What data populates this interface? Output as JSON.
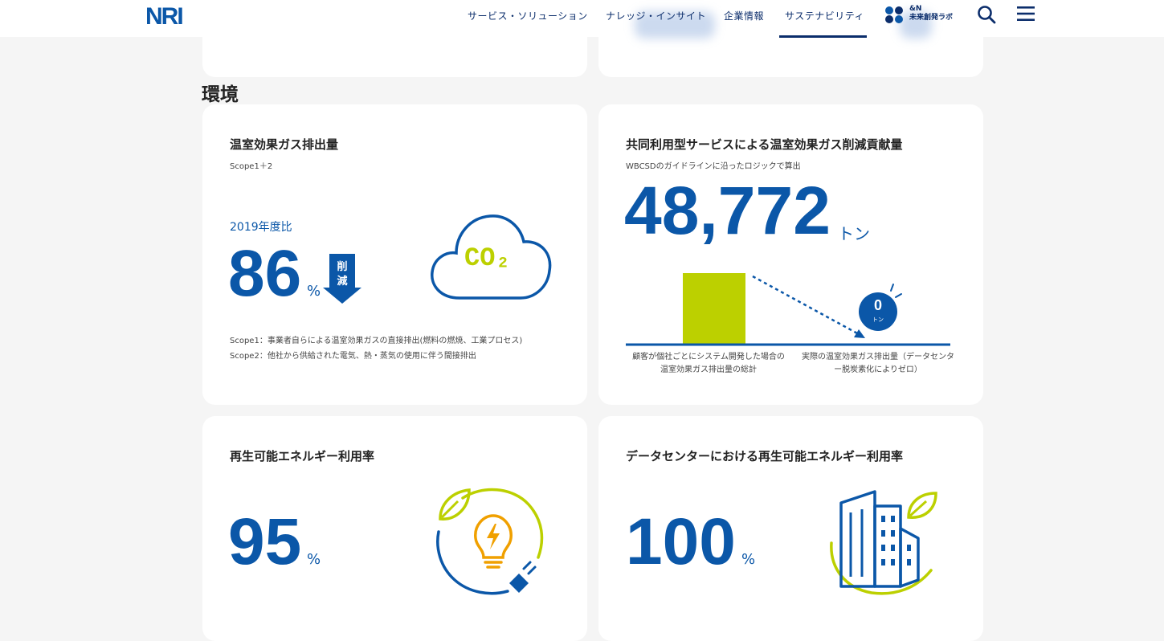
{
  "header": {
    "logo_text": "NRI",
    "nav": [
      {
        "label": "サービス・ソリューション"
      },
      {
        "label": "ナレッジ・インサイト"
      },
      {
        "label": "企業情報"
      },
      {
        "label": "サステナビリティ",
        "active": true
      }
    ],
    "lab_line1": "&N",
    "lab_line2": "未来創発ラボ",
    "search_icon": "search-icon",
    "menu_icon": "hamburger-menu-icon"
  },
  "section": {
    "title": "環境"
  },
  "cards": {
    "ghg": {
      "title": "温室効果ガス排出量",
      "subtitle": "Scope1＋2",
      "comparison_label": "2019年度比",
      "value": "86",
      "unit": "%",
      "arrow_text_1": "削",
      "arrow_text_2": "減",
      "co2_text": "CO₂",
      "notes": [
        "Scope1：事業者自らによる温室効果ガスの直接排出(燃料の燃焼、工業プロセス)",
        "Scope2：他社から供給された電気、熱・蒸気の使用に伴う間接排出"
      ]
    },
    "shared": {
      "title": "共同利用型サービスによる温室効果ガス削減貢献量",
      "subtitle": "WBCSDのガイドラインに沿ったロジックで算出",
      "value": "48,772",
      "unit": "トン",
      "zero_value": "0",
      "zero_unit": "トン",
      "caption_left": [
        "顧客が個社ごとにシステム開発した場合の",
        "温室効果ガス排出量の総計"
      ],
      "caption_right": [
        "実際の温室効果ガス排出量（データセンタ",
        "ー脱炭素化によりゼロ）"
      ]
    },
    "renewable": {
      "title": "再生可能エネルギー利用率",
      "value": "95",
      "unit": "%"
    },
    "datacenter": {
      "title": "データセンターにおける再生可能エネルギー利用率",
      "value": "100",
      "unit": "%"
    }
  },
  "colors": {
    "navy": "#0b2d6b",
    "blue": "#0b57a8",
    "lime": "#bcd000",
    "orange": "#f0a000"
  }
}
